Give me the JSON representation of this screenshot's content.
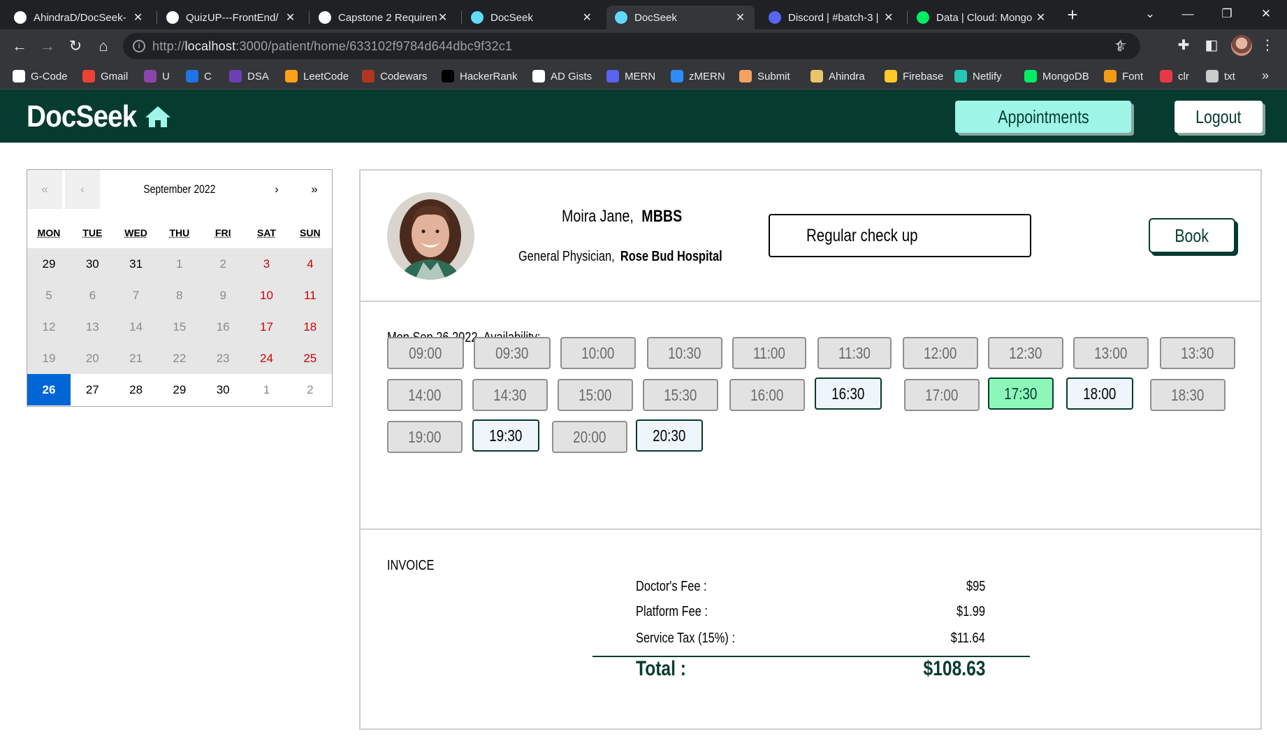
{
  "browser": {
    "tabs": [
      {
        "title": "AhindraD/DocSeek-",
        "icon": "github-icon",
        "color": "#ffffff"
      },
      {
        "title": "QuizUP---FrontEnd/",
        "icon": "github-icon",
        "color": "#ffffff"
      },
      {
        "title": "Capstone 2 Requiren",
        "icon": "github-icon",
        "color": "#ffffff"
      },
      {
        "title": "DocSeek",
        "icon": "react-icon",
        "color": "#61dafb"
      },
      {
        "title": "DocSeek",
        "icon": "react-icon",
        "color": "#61dafb",
        "active": true
      },
      {
        "title": "Discord | #batch-3 |",
        "icon": "discord-icon",
        "color": "#5865f2"
      },
      {
        "title": "Data | Cloud: Mongo",
        "icon": "mongodb-icon",
        "color": "#00ed64"
      }
    ],
    "url": {
      "scheme": "http://",
      "host": "localhost",
      "rest": ":3000/patient/home/633102f9784d644dbc9f32c1"
    },
    "bookmarks": [
      {
        "label": "G-Code",
        "icon": "google-icon",
        "color": "#ffffff"
      },
      {
        "label": "Gmail",
        "icon": "gmail-icon",
        "color": "#ea4335"
      },
      {
        "label": "U",
        "icon": "u-icon",
        "color": "#8e44ad"
      },
      {
        "label": "C",
        "icon": "c-icon",
        "color": "#1e73e8"
      },
      {
        "label": "DSA",
        "icon": "dsa-icon",
        "color": "#6c3fb5"
      },
      {
        "label": "LeetCode",
        "icon": "leetcode-icon",
        "color": "#ffa116"
      },
      {
        "label": "Codewars",
        "icon": "codewars-icon",
        "color": "#b1361e"
      },
      {
        "label": "HackerRank",
        "icon": "hackerrank-icon",
        "color": "#000000"
      },
      {
        "label": "AD Gists",
        "icon": "github-icon",
        "color": "#ffffff"
      },
      {
        "label": "MERN",
        "icon": "discord-icon",
        "color": "#5865f2"
      },
      {
        "label": "zMERN",
        "icon": "zoom-icon",
        "color": "#2d8cff"
      },
      {
        "label": "Submit",
        "icon": "submit-icon",
        "color": "#f4a261"
      },
      {
        "label": "Ahindra",
        "icon": "ahindra-icon",
        "color": "#e9c46a"
      },
      {
        "label": "Firebase",
        "icon": "firebase-icon",
        "color": "#ffca28"
      },
      {
        "label": "Netlify",
        "icon": "netlify-icon",
        "color": "#25c7b7"
      },
      {
        "label": "MongoDB",
        "icon": "mongodb-icon",
        "color": "#00ed64"
      },
      {
        "label": "Font",
        "icon": "font-icon",
        "color": "#f39c12"
      },
      {
        "label": "clr",
        "icon": "clr-icon",
        "color": "#e63946"
      },
      {
        "label": "txt",
        "icon": "txt-icon",
        "color": "#cccccc"
      }
    ],
    "more": "»"
  },
  "app": {
    "brand": "DocSeek",
    "appointments_label": "Appointments",
    "logout_label": "Logout",
    "colors": {
      "primary": "#063b2f",
      "accent": "#9ff6e8",
      "selected_slot": "#8cf7b8",
      "calendar_selected": "#0066d6"
    }
  },
  "calendar": {
    "title": "September 2022",
    "nav": {
      "prev_year": "«",
      "prev_month": "‹",
      "next_month": "›",
      "next_year": "»"
    },
    "weekdays": [
      "MON",
      "TUE",
      "WED",
      "THU",
      "FRI",
      "SAT",
      "SUN"
    ],
    "weeks": [
      [
        "29",
        "30",
        "31",
        "1",
        "2",
        "3",
        "4"
      ],
      [
        "5",
        "6",
        "7",
        "8",
        "9",
        "10",
        "11"
      ],
      [
        "12",
        "13",
        "14",
        "15",
        "16",
        "17",
        "18"
      ],
      [
        "19",
        "20",
        "21",
        "22",
        "23",
        "24",
        "25"
      ],
      [
        "26",
        "27",
        "28",
        "29",
        "30",
        "1",
        "2"
      ]
    ],
    "selected": "26"
  },
  "doctor": {
    "name": "Moira Jane,",
    "degree": "MBBS",
    "specialty": "General Physician,",
    "hospital": "Rose Bud Hospital"
  },
  "booking": {
    "reason": "Regular check up",
    "book_label": "Book"
  },
  "availability": {
    "title": "Mon Sep 26 2022, Availability:",
    "slots": [
      {
        "time": "09:00",
        "state": "booked"
      },
      {
        "time": "09:30",
        "state": "booked"
      },
      {
        "time": "10:00",
        "state": "booked"
      },
      {
        "time": "10:30",
        "state": "booked"
      },
      {
        "time": "11:00",
        "state": "booked"
      },
      {
        "time": "11:30",
        "state": "booked"
      },
      {
        "time": "12:00",
        "state": "booked"
      },
      {
        "time": "12:30",
        "state": "booked"
      },
      {
        "time": "13:00",
        "state": "booked"
      },
      {
        "time": "13:30",
        "state": "booked"
      },
      {
        "time": "14:00",
        "state": "booked"
      },
      {
        "time": "14:30",
        "state": "booked"
      },
      {
        "time": "15:00",
        "state": "booked"
      },
      {
        "time": "15:30",
        "state": "booked"
      },
      {
        "time": "16:00",
        "state": "booked"
      },
      {
        "time": "16:30",
        "state": "free"
      },
      {
        "time": "17:00",
        "state": "booked"
      },
      {
        "time": "17:30",
        "state": "selected"
      },
      {
        "time": "18:00",
        "state": "free"
      },
      {
        "time": "18:30",
        "state": "booked"
      },
      {
        "time": "19:00",
        "state": "booked"
      },
      {
        "time": "19:30",
        "state": "free"
      },
      {
        "time": "20:00",
        "state": "booked"
      },
      {
        "time": "20:30",
        "state": "free"
      }
    ]
  },
  "invoice": {
    "title": "INVOICE",
    "lines": [
      {
        "label": "Doctor's Fee :",
        "value": "$95"
      },
      {
        "label": "Platform Fee :",
        "value": "$1.99"
      },
      {
        "label": "Service Tax (15%) :",
        "value": "$11.64"
      }
    ],
    "total_label": "Total :",
    "total_value": "$108.63"
  }
}
